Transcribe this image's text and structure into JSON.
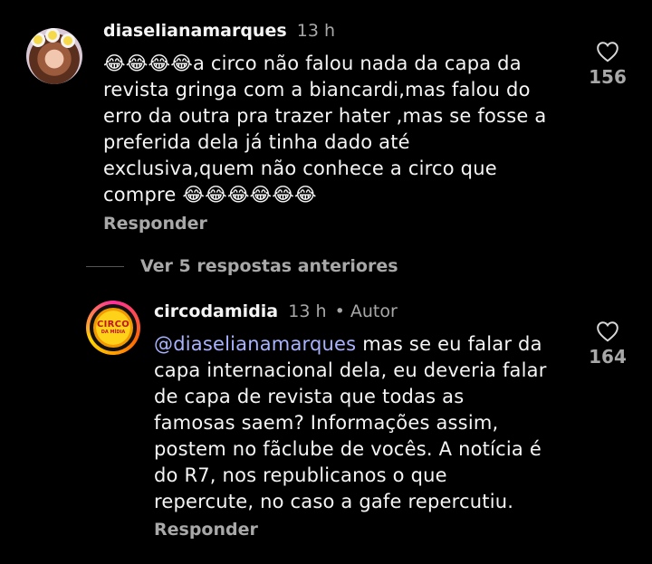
{
  "comment1": {
    "username": "diaselianamarques",
    "time": "13 h",
    "lines": [
      "😂😂😂😂a circo não falou nada da capa da",
      "revista gringa com a biancardi,mas falou do",
      "erro da outra pra trazer hater ,mas se fosse a",
      "preferida dela já tinha dado até",
      "exclusiva,quem não conhece a circo que",
      "compre 😂😂😂😂😂😂"
    ],
    "reply_label": "Responder",
    "likes": "156"
  },
  "view_replies_label": "Ver 5 respostas anteriores",
  "comment2": {
    "username": "circodamidia",
    "time": "13 h",
    "author_tag": "• Autor",
    "mention": "@diaselianamarques",
    "line1_rest": " mas se eu falar da",
    "lines": [
      "capa internacional dela, eu deveria falar",
      "de capa de revista que todas as",
      "famosas saem? Informações assim,",
      "postem no fãclube de vocês. A notícia é",
      "do R7, nos republicanos o que",
      "repercute, no caso a gafe repercutiu."
    ],
    "reply_label": "Responder",
    "likes": "164",
    "avatar_text_big": "CIRCO",
    "avatar_text_small": "DA MÍDIA"
  },
  "icons": {
    "like": "heart-outline-icon"
  },
  "colors": {
    "background": "#000000",
    "mention": "#a9b3ff",
    "secondary": "#a8a8a8"
  }
}
